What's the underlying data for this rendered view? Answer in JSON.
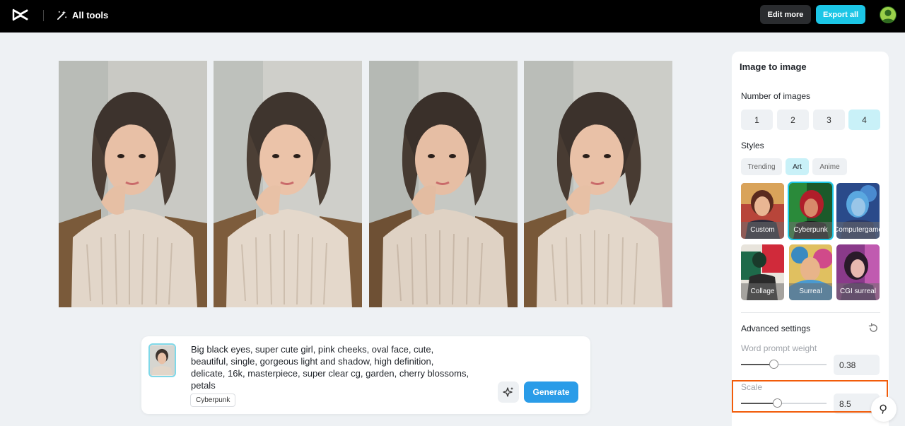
{
  "topbar": {
    "all_tools_label": "All tools",
    "edit_more_label": "Edit more",
    "export_all_label": "Export all",
    "accent_color": "#1cc6e6"
  },
  "gallery": {
    "images": [
      {
        "name": "generated-image-1"
      },
      {
        "name": "generated-image-2"
      },
      {
        "name": "generated-image-3"
      },
      {
        "name": "generated-image-4"
      }
    ]
  },
  "prompt": {
    "line1": "Big black eyes, super cute girl, pink cheeks, oval face, cute,",
    "line2": "beautiful, single, gorgeous light and shadow, high definition,",
    "line3": "delicate, 16k, masterpiece, super clear cg, garden, cherry blossoms,",
    "line4": "petals",
    "style_tag": "Cyberpunk",
    "generate_label": "Generate"
  },
  "panel": {
    "title": "Image to image",
    "number_label": "Number of images",
    "numbers": [
      "1",
      "2",
      "3",
      "4"
    ],
    "selected_number": "4",
    "styles_label": "Styles",
    "style_tabs": [
      "Trending",
      "Art",
      "Anime"
    ],
    "active_tab": "Art",
    "style_cards": [
      {
        "label": "Custom"
      },
      {
        "label": "Cyberpunk"
      },
      {
        "label_line1": "Computer",
        "label_line2": "game"
      },
      {
        "label": "Collage"
      },
      {
        "label": "Surreal"
      },
      {
        "label": "CGI surreal"
      }
    ],
    "selected_style": "Cyberpunk",
    "advanced_label": "Advanced settings",
    "word_weight_label": "Word prompt weight",
    "word_weight_value": "0.38",
    "word_weight_fraction": 0.38,
    "scale_label": "Scale",
    "scale_value": "8.5",
    "scale_fraction": 0.42
  }
}
